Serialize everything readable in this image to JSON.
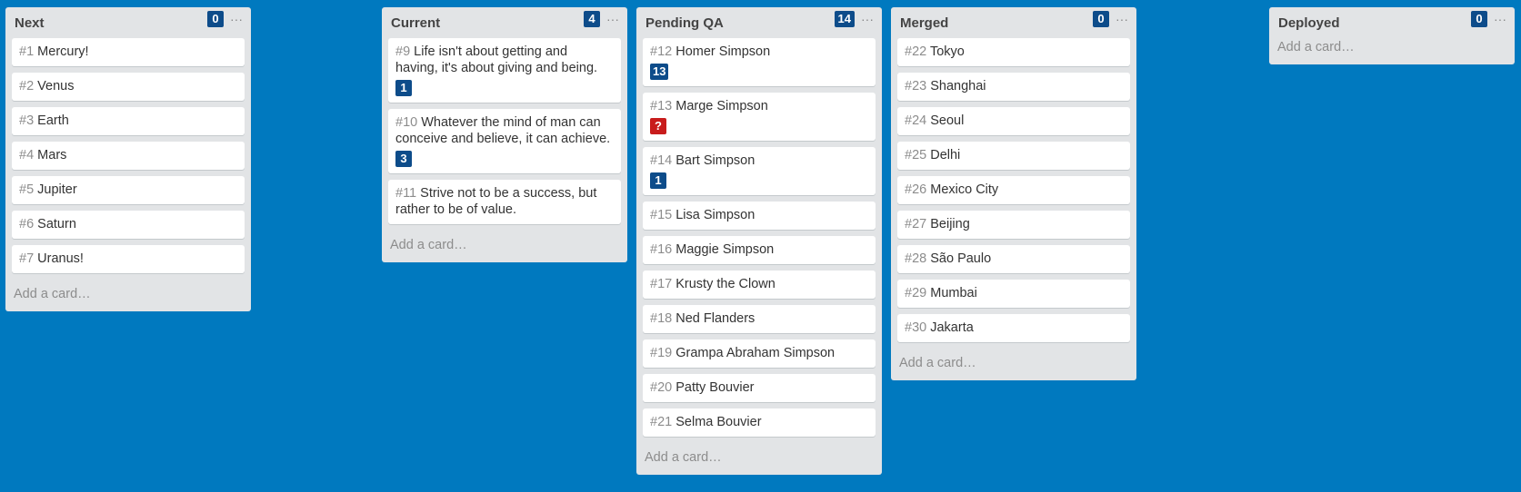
{
  "lists": [
    {
      "title": "Next",
      "count": "0",
      "menu": "···",
      "add_card": "Add a card…",
      "cards": [
        {
          "num": "#1",
          "title": "Mercury!"
        },
        {
          "num": "#2",
          "title": "Venus"
        },
        {
          "num": "#3",
          "title": "Earth"
        },
        {
          "num": "#4",
          "title": "Mars"
        },
        {
          "num": "#5",
          "title": "Jupiter"
        },
        {
          "num": "#6",
          "title": "Saturn"
        },
        {
          "num": "#7",
          "title": "Uranus!"
        }
      ]
    },
    {
      "title": "Current",
      "count": "4",
      "menu": "···",
      "add_card": "Add a card…",
      "cards": [
        {
          "num": "#9",
          "title": "Life isn't about getting and having, it's about giving and being.",
          "badge": "1"
        },
        {
          "num": "#10",
          "title": "Whatever the mind of man can conceive and believe, it can achieve.",
          "badge": "3"
        },
        {
          "num": "#11",
          "title": "Strive not to be a success, but rather to be of value."
        }
      ]
    },
    {
      "title": "Pending QA",
      "count": "14",
      "menu": "···",
      "add_card": "Add a card…",
      "cards": [
        {
          "num": "#12",
          "title": "Homer Simpson",
          "badge": "13"
        },
        {
          "num": "#13",
          "title": "Marge Simpson",
          "badge": "?",
          "badge_alert": true
        },
        {
          "num": "#14",
          "title": "Bart Simpson",
          "badge": "1"
        },
        {
          "num": "#15",
          "title": "Lisa Simpson"
        },
        {
          "num": "#16",
          "title": "Maggie Simpson"
        },
        {
          "num": "#17",
          "title": "Krusty the Clown"
        },
        {
          "num": "#18",
          "title": "Ned Flanders"
        },
        {
          "num": "#19",
          "title": "Grampa Abraham Simpson"
        },
        {
          "num": "#20",
          "title": "Patty Bouvier"
        },
        {
          "num": "#21",
          "title": "Selma Bouvier"
        }
      ]
    },
    {
      "title": "Merged",
      "count": "0",
      "menu": "···",
      "add_card": "Add a card…",
      "cards": [
        {
          "num": "#22",
          "title": "Tokyo"
        },
        {
          "num": "#23",
          "title": "Shanghai"
        },
        {
          "num": "#24",
          "title": "Seoul"
        },
        {
          "num": "#25",
          "title": "Delhi"
        },
        {
          "num": "#26",
          "title": "Mexico City"
        },
        {
          "num": "#27",
          "title": "Beijing"
        },
        {
          "num": "#28",
          "title": "São Paulo"
        },
        {
          "num": "#29",
          "title": "Mumbai"
        },
        {
          "num": "#30",
          "title": "Jakarta"
        }
      ]
    },
    {
      "title": "Deployed",
      "count": "0",
      "menu": "···",
      "add_card": "Add a card…",
      "cards": []
    }
  ],
  "colors": {
    "board_bg": "#0079bf",
    "list_bg": "#e2e4e6",
    "badge": "#0d4c8a",
    "badge_alert": "#c81c1c"
  }
}
